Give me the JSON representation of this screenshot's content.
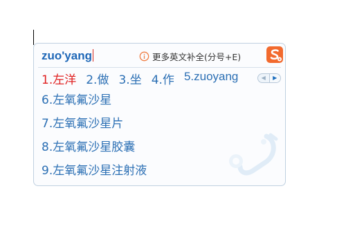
{
  "ime": {
    "pinyin": "zuo'yang",
    "hint": "更多英文补全(分号+E)",
    "icons": {
      "hint": "info-icon",
      "logo": "sogou-logo-icon",
      "prev": "prev-page-icon",
      "next": "next-page-icon",
      "decoration": "stethoscope-skin-icon"
    },
    "candidates": [
      "1.左洋",
      "2.做",
      "3.坐",
      "4.作",
      "5.zuoyang"
    ],
    "more_candidates": [
      "6.左氧氟沙星",
      "7.左氧氟沙星片",
      "8.左氧氟沙星胶囊",
      "9.左氧氟沙星注射液"
    ],
    "colors": {
      "accent": "#2b6fb4",
      "highlight": "#e02020",
      "pinyin": "#1e67b7",
      "logo": "#f26a2e"
    }
  }
}
